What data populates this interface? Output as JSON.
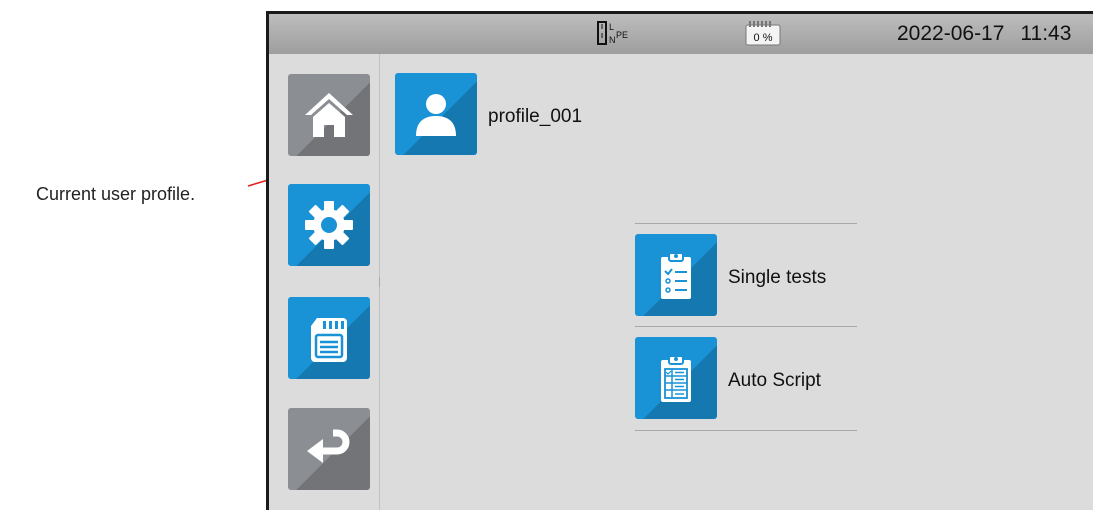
{
  "annotation": {
    "text": "Current user profile.",
    "line_color": "#e02020"
  },
  "statusbar": {
    "date": "2022-06-17",
    "time": "11:43",
    "battery_percent": "0 %",
    "plug_labels": {
      "L": "L",
      "N": "N",
      "PE": "PE"
    }
  },
  "sidebar": {
    "buttons": [
      {
        "name": "home",
        "icon": "home-icon",
        "color": "#8b8e92"
      },
      {
        "name": "settings",
        "icon": "gear-icon",
        "color": "#1a92d6"
      },
      {
        "name": "memory",
        "icon": "sd-card-icon",
        "color": "#1a92d6"
      },
      {
        "name": "back",
        "icon": "return-arrow-icon",
        "color": "#8b8e92"
      }
    ]
  },
  "profile": {
    "name": "profile_001",
    "icon": "user-icon"
  },
  "menu": {
    "items": [
      {
        "label": "Single tests",
        "icon": "clipboard-checklist-icon"
      },
      {
        "label": "Auto Script",
        "icon": "clipboard-script-icon"
      }
    ]
  },
  "colors": {
    "accent": "#1a92d6",
    "neutral": "#8b8e92",
    "background": "#dcdcdc"
  }
}
